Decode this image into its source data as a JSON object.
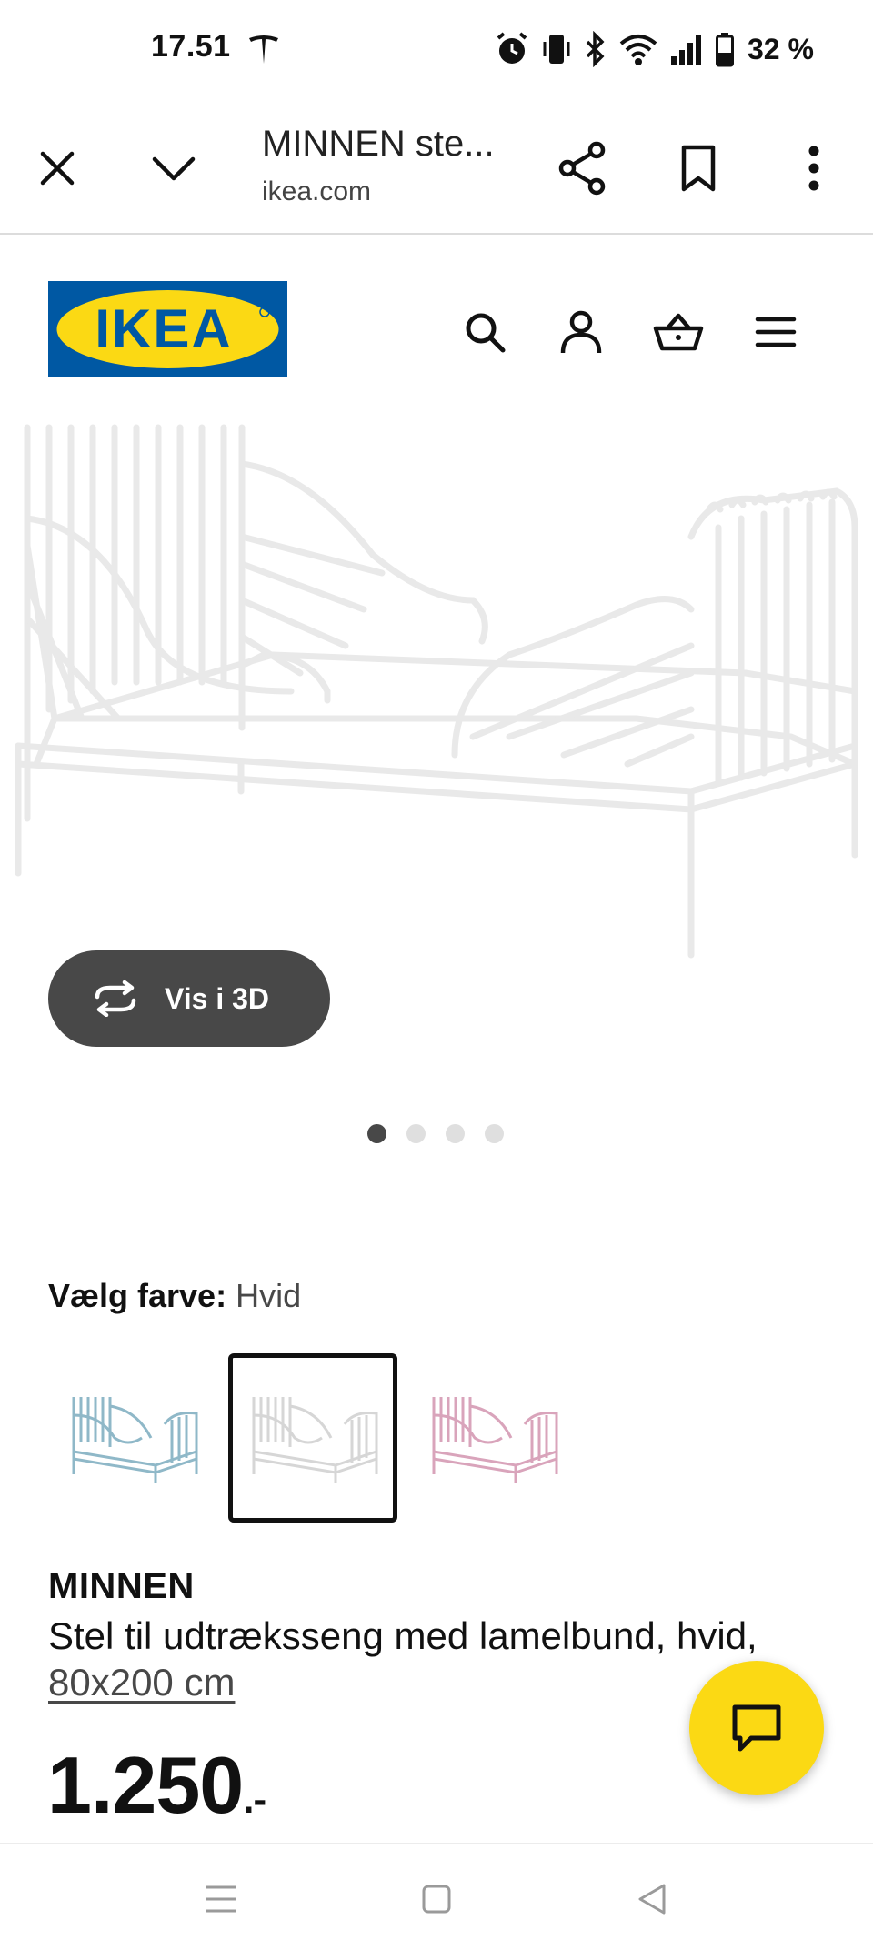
{
  "status_bar": {
    "time": "17.51",
    "battery_text": "32 %",
    "icons": [
      "tesla-icon",
      "alarm-icon",
      "vibrate-icon",
      "bluetooth-icon",
      "wifi-icon",
      "signal-icon",
      "battery-icon"
    ]
  },
  "browser": {
    "title": "MINNEN ste...",
    "url": "ikea.com",
    "icons": [
      "close-icon",
      "chevron-down-icon",
      "share-icon",
      "bookmark-icon",
      "more-vert-icon"
    ]
  },
  "header": {
    "logo_text": "IKEA",
    "icons": [
      "search-icon",
      "account-icon",
      "basket-icon",
      "menu-icon"
    ]
  },
  "product": {
    "view3d_label": "Vis i 3D",
    "carousel": {
      "count": 4,
      "active": 1
    },
    "color_label": "Vælg farve:",
    "color_value": "Hvid",
    "swatches": [
      {
        "color": "#8fb8c8",
        "selected": false
      },
      {
        "color": "#e6e6e6",
        "selected": true
      },
      {
        "color": "#d9a4bb",
        "selected": false
      }
    ],
    "name": "MINNEN",
    "description": "Stel til udtræksseng med lamelbund, hvid,",
    "size": "80x200 cm",
    "price": "1.250",
    "price_suffix": ".-"
  },
  "colors": {
    "ikea_blue": "#0058a3",
    "ikea_yellow": "#fbd914",
    "dark_button": "#484848"
  },
  "nav_bar": {
    "icons": [
      "recents-icon",
      "home-icon",
      "back-icon"
    ]
  }
}
